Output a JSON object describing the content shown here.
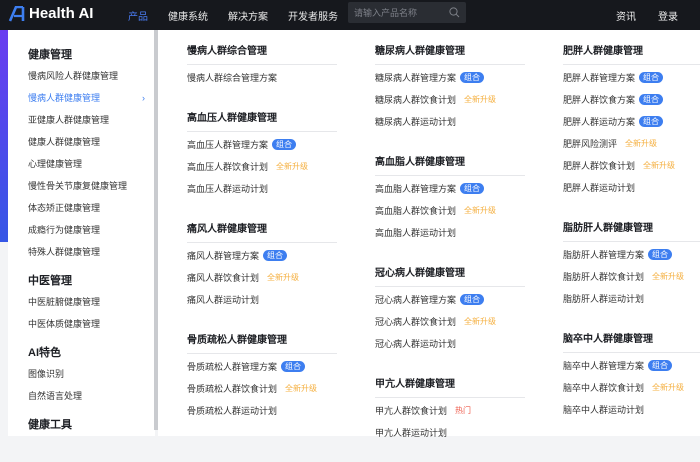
{
  "header": {
    "logo": "Health AI",
    "nav": [
      "产品",
      "健康系统",
      "解决方案",
      "开发者服务"
    ],
    "active_nav": 0,
    "search_placeholder": "请输入产品名称",
    "right": [
      "资讯",
      "登录"
    ]
  },
  "colors": {
    "accent": "#3d7ef0",
    "upgrade": "#f5b041",
    "hot": "#ee5a4a"
  },
  "sidebar": [
    {
      "heading": "健康管理",
      "items": [
        "慢病风险人群健康管理",
        "慢病人群健康管理",
        "亚健康人群健康管理",
        "健康人群健康管理",
        "心理健康管理",
        "慢性骨关节康复健康管理",
        "体态矫正健康管理",
        "成瘾行为健康管理",
        "特殊人群健康管理"
      ],
      "active": 1
    },
    {
      "heading": "中医管理",
      "items": [
        "中医脏腑健康管理",
        "中医体质健康管理"
      ]
    },
    {
      "heading": "AI特色",
      "items": [
        "图像识别",
        "自然语言处理"
      ]
    },
    {
      "heading": "健康工具",
      "items": []
    }
  ],
  "tags": {
    "combo": "组合",
    "upgrade": "全新升级",
    "hot": "热门"
  },
  "columns": [
    [
      {
        "heading": "慢病人群综合管理",
        "items": [
          {
            "label": "慢病人群综合管理方案"
          }
        ]
      },
      {
        "heading": "高血压人群健康管理",
        "items": [
          {
            "label": "高血压人群管理方案",
            "tag": "combo"
          },
          {
            "label": "高血压人群饮食计划",
            "tag": "upgrade"
          },
          {
            "label": "高血压人群运动计划"
          }
        ]
      },
      {
        "heading": "痛风人群健康管理",
        "items": [
          {
            "label": "痛风人群管理方案",
            "tag": "combo"
          },
          {
            "label": "痛风人群饮食计划",
            "tag": "upgrade"
          },
          {
            "label": "痛风人群运动计划"
          }
        ]
      },
      {
        "heading": "骨质疏松人群健康管理",
        "items": [
          {
            "label": "骨质疏松人群管理方案",
            "tag": "combo"
          },
          {
            "label": "骨质疏松人群饮食计划",
            "tag": "upgrade"
          },
          {
            "label": "骨质疏松人群运动计划"
          }
        ]
      }
    ],
    [
      {
        "heading": "糖尿病人群健康管理",
        "items": [
          {
            "label": "糖尿病人群管理方案",
            "tag": "combo"
          },
          {
            "label": "糖尿病人群饮食计划",
            "tag": "upgrade"
          },
          {
            "label": "糖尿病人群运动计划"
          }
        ]
      },
      {
        "heading": "高血脂人群健康管理",
        "items": [
          {
            "label": "高血脂人群管理方案",
            "tag": "combo"
          },
          {
            "label": "高血脂人群饮食计划",
            "tag": "upgrade"
          },
          {
            "label": "高血脂人群运动计划"
          }
        ]
      },
      {
        "heading": "冠心病人群健康管理",
        "items": [
          {
            "label": "冠心病人群管理方案",
            "tag": "combo"
          },
          {
            "label": "冠心病人群饮食计划",
            "tag": "upgrade"
          },
          {
            "label": "冠心病人群运动计划"
          }
        ]
      },
      {
        "heading": "甲亢人群健康管理",
        "items": [
          {
            "label": "甲亢人群饮食计划",
            "tag": "hot"
          },
          {
            "label": "甲亢人群运动计划"
          }
        ]
      }
    ],
    [
      {
        "heading": "肥胖人群健康管理",
        "items": [
          {
            "label": "肥胖人群管理方案",
            "tag": "combo"
          },
          {
            "label": "肥胖人群饮食方案",
            "tag": "combo"
          },
          {
            "label": "肥胖人群运动方案",
            "tag": "combo"
          },
          {
            "label": "肥胖风险测评",
            "tag": "upgrade"
          },
          {
            "label": "肥胖人群饮食计划",
            "tag": "upgrade"
          },
          {
            "label": "肥胖人群运动计划"
          }
        ]
      },
      {
        "heading": "脂肪肝人群健康管理",
        "items": [
          {
            "label": "脂肪肝人群管理方案",
            "tag": "combo"
          },
          {
            "label": "脂肪肝人群饮食计划",
            "tag": "upgrade"
          },
          {
            "label": "脂肪肝人群运动计划"
          }
        ]
      },
      {
        "heading": "脑卒中人群健康管理",
        "items": [
          {
            "label": "脑卒中人群管理方案",
            "tag": "combo"
          },
          {
            "label": "脑卒中人群饮食计划",
            "tag": "upgrade"
          },
          {
            "label": "脑卒中人群运动计划"
          }
        ]
      }
    ]
  ]
}
